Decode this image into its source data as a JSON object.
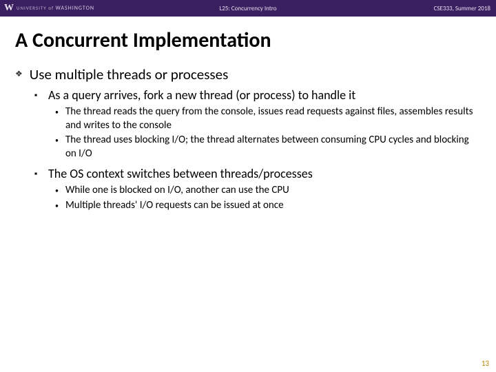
{
  "header": {
    "logo_w": "W",
    "logo_text_small": "UNIVERSITY of ",
    "logo_text_main": "WASHINGTON",
    "center": "L25: Concurrency Intro",
    "right": "CSE333, Summer 2018"
  },
  "title": "A Concurrent Implementation",
  "l1_a": "Use multiple threads or processes",
  "l2_a": "As a query arrives, fork a new thread (or process) to handle it",
  "l3_a": "The thread reads the query from the console, issues read requests against files, assembles results and writes to the console",
  "l3_b": "The thread uses blocking I/O; the thread alternates between consuming CPU cycles and blocking on I/O",
  "l2_b": "The OS context switches between threads/processes",
  "l3_c": "While one is blocked on I/O, another can use the CPU",
  "l3_d": "Multiple threads' I/O requests can be issued at once",
  "page_number": "13"
}
